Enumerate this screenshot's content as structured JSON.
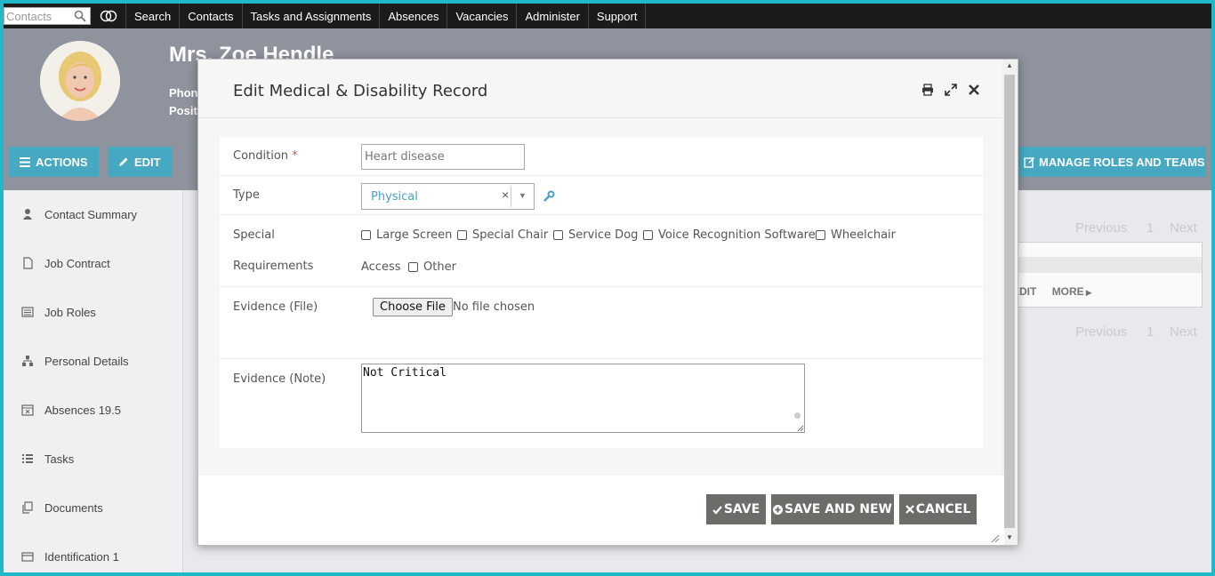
{
  "topnav": {
    "search_placeholder": "Contacts",
    "items": [
      "Search",
      "Contacts",
      "Tasks and Assignments",
      "Absences",
      "Vacancies",
      "Administer",
      "Support"
    ]
  },
  "header": {
    "name": "Mrs. Zoe Hendle",
    "phone_label": "Phon",
    "position_label": "Posit"
  },
  "actions": {
    "actions_label": "ACTIONS",
    "edit_label": "EDIT",
    "manage_roles_label": "MANAGE ROLES AND TEAMS"
  },
  "sidebar": {
    "items": [
      {
        "label": "Contact Summary",
        "icon": "user-icon"
      },
      {
        "label": "Job Contract",
        "icon": "file-icon"
      },
      {
        "label": "Job Roles",
        "icon": "list-box-icon"
      },
      {
        "label": "Personal Details",
        "icon": "sitemap-icon"
      },
      {
        "label": "Absences 19.5",
        "icon": "calendar-x-icon"
      },
      {
        "label": "Tasks",
        "icon": "list-icon"
      },
      {
        "label": "Documents",
        "icon": "documents-icon"
      },
      {
        "label": "Identification 1",
        "icon": "id-card-icon"
      }
    ]
  },
  "background": {
    "previous": "Previous",
    "page": "1",
    "next": "Next",
    "edit": "EDIT",
    "more": "MORE"
  },
  "modal": {
    "title": "Edit Medical & Disability Record",
    "condition_label": "Condition",
    "required_mark": "*",
    "condition_value": "Heart disease",
    "type_label": "Type",
    "type_value": "Physical",
    "type_clear": "×",
    "special_label": "Special",
    "requirements_label": "Requirements",
    "options": [
      "Large Screen",
      "Special Chair",
      "Service Dog",
      "Voice Recognition Software",
      "Wheelchair"
    ],
    "access_label": "Access",
    "other_label": "Other",
    "evidence_file_label": "Evidence (File)",
    "choose_file_label": "Choose File",
    "file_status": "No file chosen",
    "evidence_note_label": "Evidence (Note)",
    "evidence_note_value": "Not Critical",
    "save_label": "SAVE",
    "save_new_label": "SAVE AND NEW",
    "cancel_label": "CANCEL"
  }
}
